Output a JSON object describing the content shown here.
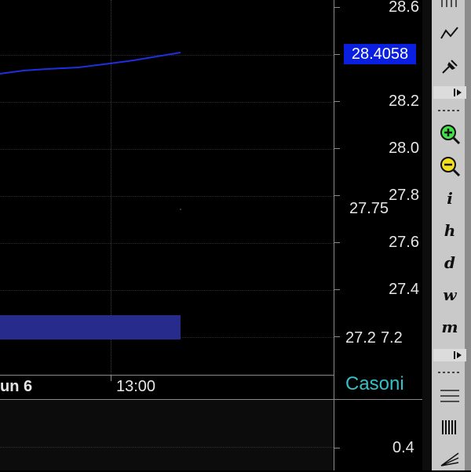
{
  "chart": {
    "price_axis_labels": [
      "28.6",
      "28.4",
      "28.2",
      "28.0",
      "27.8",
      "27.6",
      "27.4",
      "27.2"
    ],
    "current_price": "28.4058",
    "overlay_value": "27.75",
    "volume_labels": [
      "27.2",
      "7.2"
    ],
    "time_labels": [
      "un 6",
      "13:00"
    ],
    "brand": "Casoni",
    "sub_axis_label": "0.4",
    "line_color": "#1f2fe0",
    "volume_color": "#272b8c",
    "price_badge_color": "#0a1fe0"
  },
  "toolbar": {
    "buttons": [
      {
        "icon": "grid-lines-icon"
      },
      {
        "icon": "trend-line-icon"
      },
      {
        "icon": "pin-icon"
      },
      {
        "icon": "zoom-in-icon"
      },
      {
        "icon": "zoom-out-icon"
      },
      {
        "label": "i"
      },
      {
        "label": "h"
      },
      {
        "label": "d"
      },
      {
        "label": "w"
      },
      {
        "label": "m"
      },
      {
        "icon": "horizontal-lines-icon"
      },
      {
        "icon": "vertical-lines-icon"
      },
      {
        "icon": "fan-icon"
      }
    ]
  }
}
